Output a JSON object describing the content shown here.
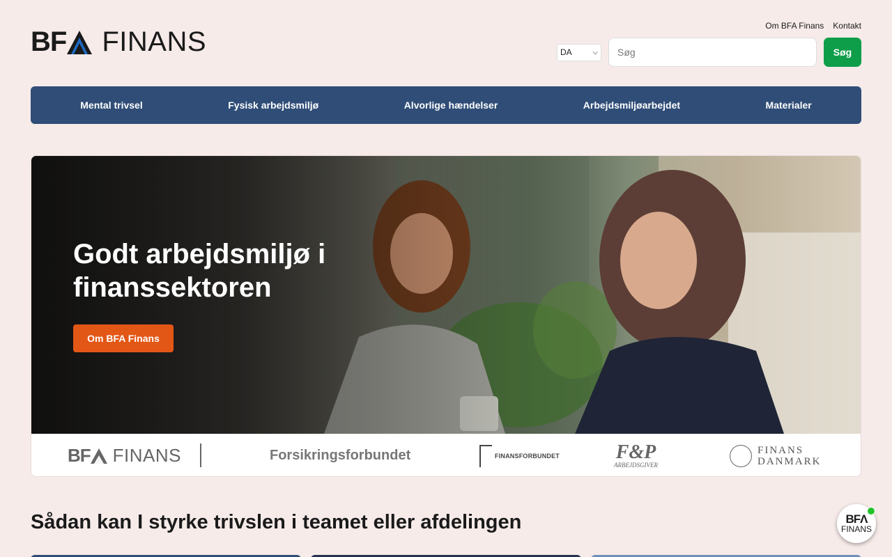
{
  "brand": {
    "logo_bfa": "BF",
    "logo_finans": "FINANS",
    "logo_colors": {
      "blue": "#1f6bc4",
      "dark": "#1a1a1a"
    }
  },
  "toplinks": {
    "about": "Om BFA Finans",
    "contact": "Kontakt"
  },
  "search": {
    "lang_value": "DA",
    "placeholder": "Søg",
    "button_label": "Søg"
  },
  "nav": {
    "items": [
      {
        "label": "Mental trivsel"
      },
      {
        "label": "Fysisk arbejdsmiljø"
      },
      {
        "label": "Alvorlige hændelser"
      },
      {
        "label": "Arbejdsmiljøarbejdet"
      },
      {
        "label": "Materialer"
      }
    ]
  },
  "hero": {
    "title": "Godt arbejdsmiljø i finanssektoren",
    "button_label": "Om BFA Finans"
  },
  "partners": {
    "bfa_b": "BF",
    "bfa_f": "FINANS",
    "forsikringsforbundet": "Forsikringsforbundet",
    "finansforbundet": "FINANSFORBUNDET",
    "fp_big": "F&P",
    "fp_small": "ARBEJDSGIVER",
    "finans_danmark_1": "FINANS",
    "finans_danmark_2": "DANMARK"
  },
  "section": {
    "title": "Sådan kan I styrke trivslen i teamet eller afdelingen"
  },
  "chat": {
    "line1": "BF",
    "line2": "FINANS"
  },
  "colors": {
    "nav_bg": "#2f4d77",
    "search_btn": "#0e9e4a",
    "hero_btn": "#e35716",
    "page_bg": "#f6ebe9"
  }
}
